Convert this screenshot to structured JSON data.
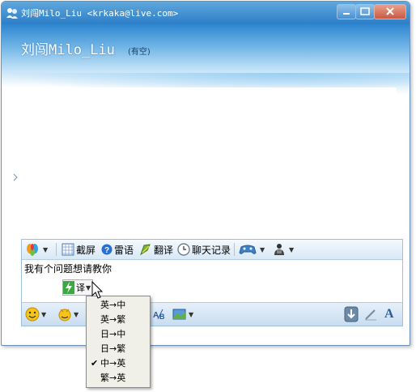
{
  "window": {
    "title": "刘闯Milo_Liu <krkaka@live.com>",
    "controls": [
      "minimize-icon",
      "maximize-icon",
      "close-icon"
    ]
  },
  "contact": {
    "name": "刘闯Milo_Liu",
    "status": "(有空)"
  },
  "toolbar": {
    "items": [
      {
        "icon": "msn-butterfly-icon",
        "label": ""
      },
      {
        "icon": "screenshot-icon",
        "label": "截屏"
      },
      {
        "icon": "help-icon",
        "label": "雷语"
      },
      {
        "icon": "translate-icon",
        "label": "翻译"
      },
      {
        "icon": "clock-icon",
        "label": "聊天记录"
      },
      {
        "icon": "gamepad-icon",
        "label": ""
      },
      {
        "icon": "person-icon",
        "label": ""
      }
    ]
  },
  "input": {
    "text": "我有个问题想请教你",
    "translate_tag": "译"
  },
  "format_toolbar": {
    "items": [
      "emoticon-icon",
      "wink-icon",
      "spellcheck-icon",
      "background-icon",
      "send-file-icon",
      "handwriting-icon",
      "font-icon"
    ],
    "font_label": "A"
  },
  "translate_menu": {
    "items": [
      {
        "label": "英→中",
        "checked": false
      },
      {
        "label": "英→繁",
        "checked": false
      },
      {
        "label": "日→中",
        "checked": false
      },
      {
        "label": "日→繁",
        "checked": false
      },
      {
        "label": "中→英",
        "checked": true
      },
      {
        "label": "繁→英",
        "checked": false
      }
    ],
    "check_mark": "✔"
  },
  "colors": {
    "title_bar": "#2d7ec8",
    "header_top": "#2e86d0",
    "toolbar_bg": "#d8e8f6",
    "menu_bg": "#f0efe8"
  }
}
